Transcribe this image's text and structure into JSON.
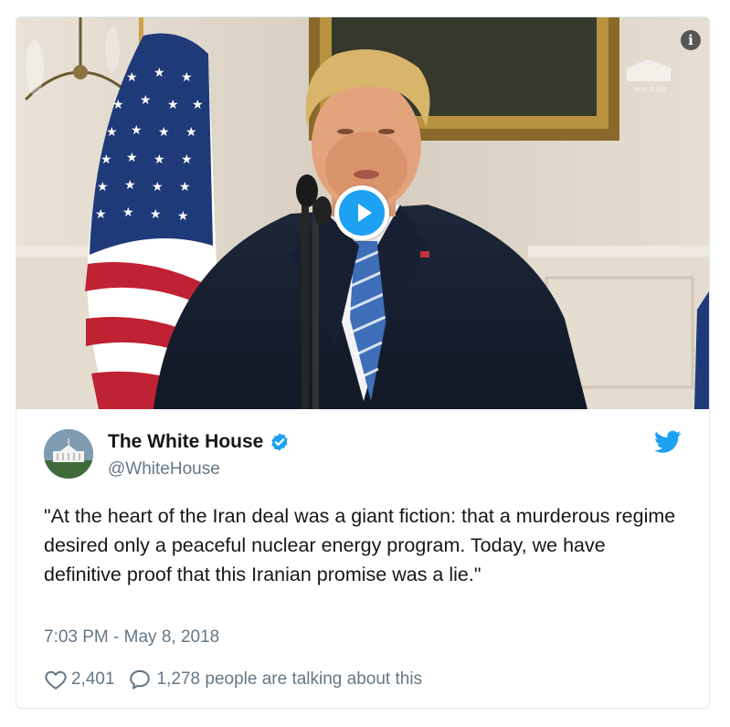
{
  "media": {
    "watermark": "WH.GOV",
    "info_icon": "info-icon",
    "play_icon": "play-icon",
    "info_glyph": "i"
  },
  "author": {
    "display_name": "The White House",
    "handle": "@WhiteHouse",
    "verified_icon": "verified-badge-icon",
    "platform_icon": "twitter-bird-icon"
  },
  "tweet": {
    "text": "\"At the heart of the Iran deal was a giant fiction: that a murderous regime desired only a peaceful nuclear energy program. Today, we have definitive proof that this Iranian promise was a lie.\"",
    "timestamp": "7:03 PM - May 8, 2018"
  },
  "actions": {
    "like_icon": "heart-icon",
    "like_count": "2,401",
    "reply_icon": "speech-bubble-icon",
    "reply_text": "1,278 people are talking about this"
  },
  "colors": {
    "accent": "#1da1f2",
    "text": "#14171a",
    "secondary_text": "#657786",
    "border": "#e1e8ed"
  }
}
